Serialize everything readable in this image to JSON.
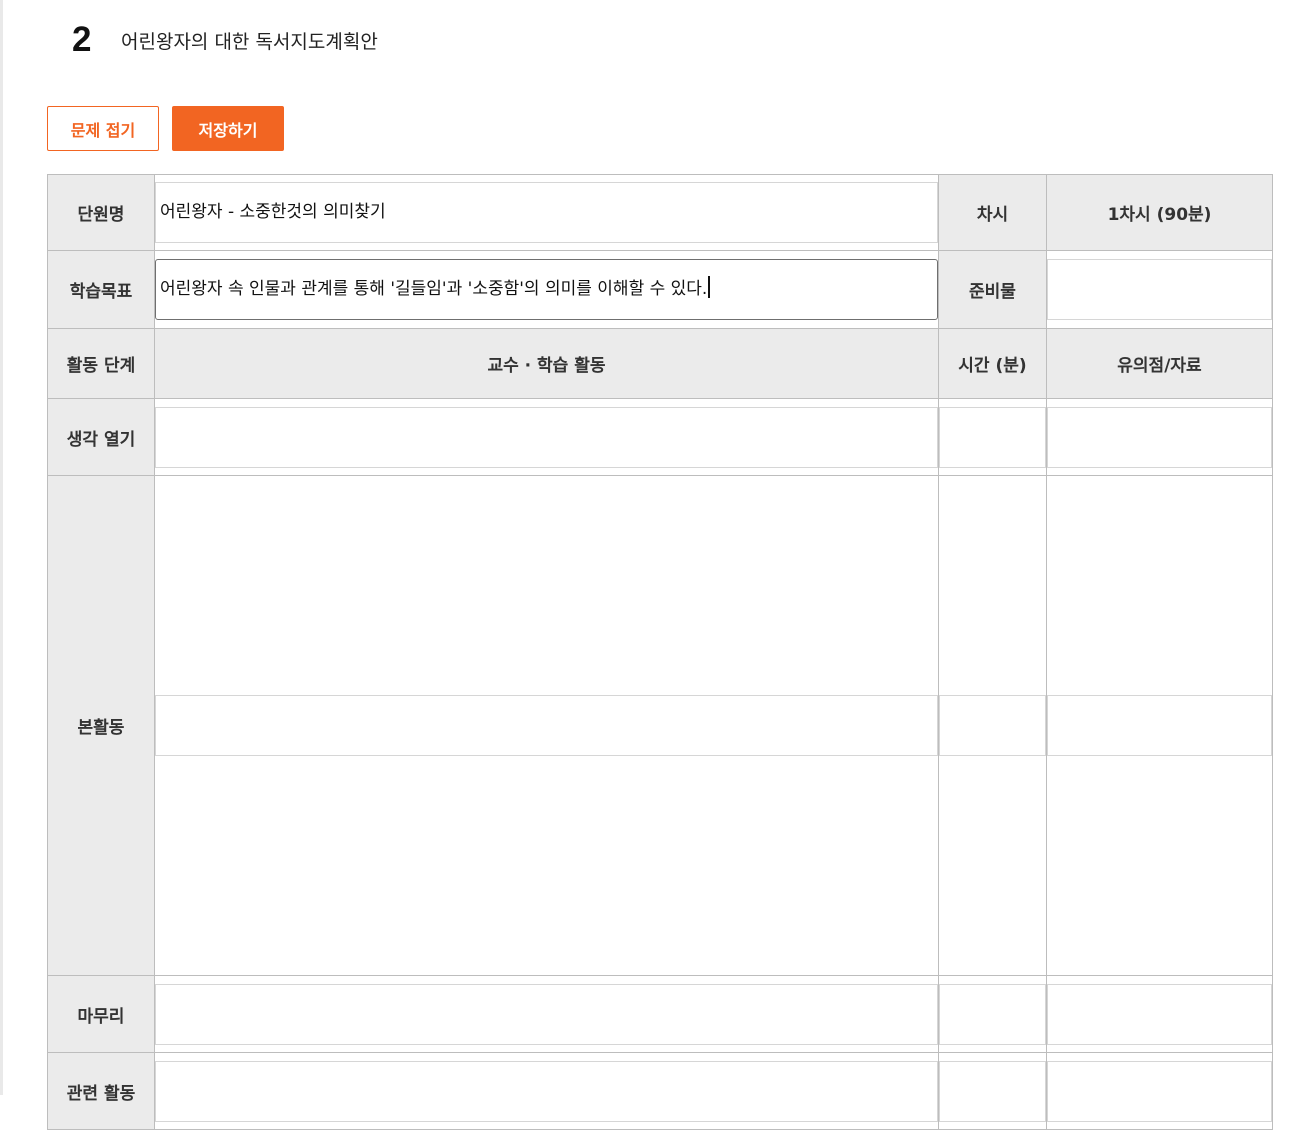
{
  "question": {
    "number": "2",
    "title": "어린왕자의 대한 독서지도계획안"
  },
  "buttons": {
    "collapse_label": "문제 접기",
    "save_label": "저장하기"
  },
  "plan": {
    "unit_label": "단원명",
    "unit_value": "어린왕자 - 소중한것의 의미찾기",
    "session_label": "차시",
    "session_value": "1차시 (90분)",
    "goal_label": "학습목표",
    "goal_value": "어린왕자 속 인물과 관계를 통해 '길들임'과 '소중함'의 의미를 이해할 수 있다.",
    "materials_label": "준비물",
    "materials_value": "",
    "headers": {
      "stage": "활동 단계",
      "activity": "교수 · 학습 활동",
      "time": "시간 (분)",
      "notes": "유의점/자료"
    },
    "rows": [
      {
        "stage": "생각 열기",
        "activity": "",
        "time": "",
        "notes": ""
      },
      {
        "stage": "본활동",
        "activity": "",
        "time": "",
        "notes": ""
      },
      {
        "stage": "마무리",
        "activity": "",
        "time": "",
        "notes": ""
      },
      {
        "stage": "관련 활동",
        "activity": "",
        "time": "",
        "notes": ""
      }
    ]
  }
}
